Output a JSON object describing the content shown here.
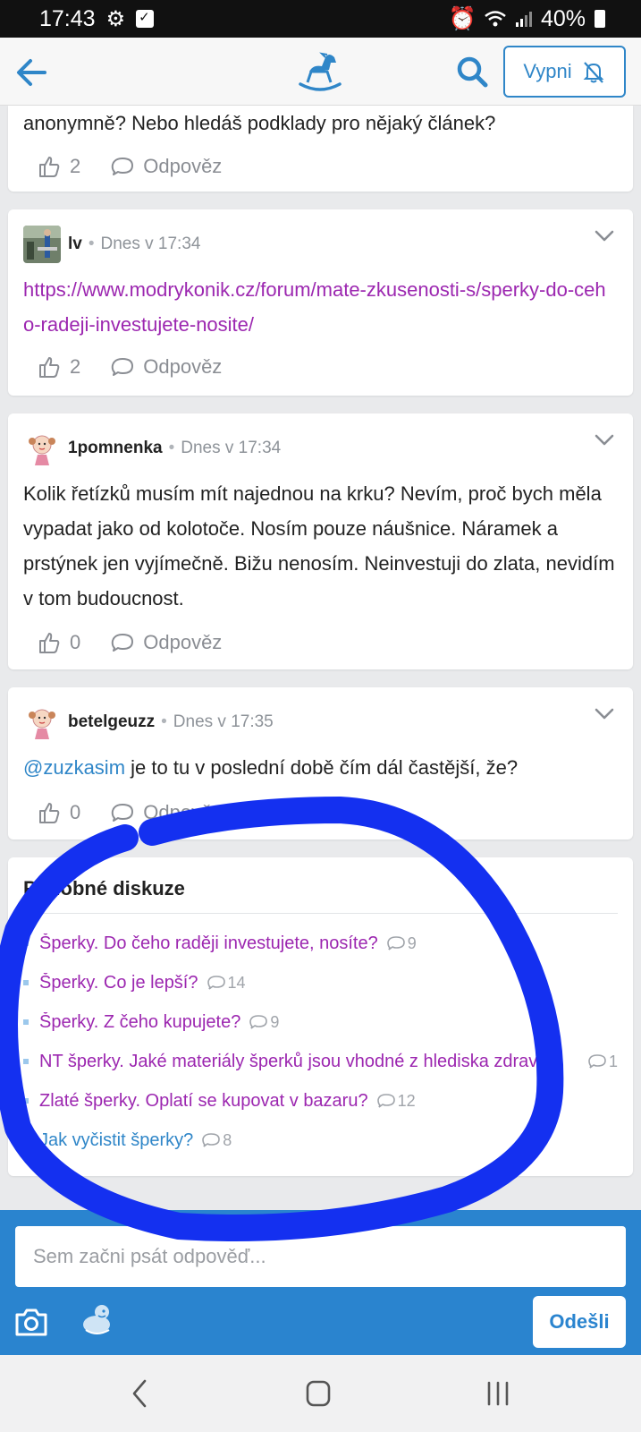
{
  "status_bar": {
    "time": "17:43",
    "battery": "40%"
  },
  "header": {
    "mute_label": "Vypni"
  },
  "posts": [
    {
      "text": "anonymně? Nebo hledáš podklady pro nějaký článek?",
      "likes": "2",
      "reply_label": "Odpověz"
    },
    {
      "username": "lv",
      "time": "Dnes v 17:34",
      "link": "https://www.modrykonik.cz/forum/mate-zkusenosti-s/sperky-do-ceho-radeji-investujete-nosite/",
      "likes": "2",
      "reply_label": "Odpověz"
    },
    {
      "username": "1pomnenka",
      "time": "Dnes v 17:34",
      "text": "Kolik řetízků musím mít najednou na krku? Nevím, proč bych měla vypadat jako od kolotoče. Nosím pouze náušnice. Náramek a prstýnek jen vyjímečně. Bižu nenosím. Neinvestuji do zlata, nevidím v tom budoucnost.",
      "likes": "0",
      "reply_label": "Odpověz"
    },
    {
      "username": "betelgeuzz",
      "time": "Dnes v 17:35",
      "mention": "@zuzkasim",
      "text": " je to tu v poslední době čím dál častější, že?",
      "likes": "0",
      "reply_label": "Odpověz"
    }
  ],
  "similar": {
    "title": "Podobné diskuze",
    "items": [
      {
        "title": "Šperky. Do čeho raději investujete, nosíte?",
        "count": "9"
      },
      {
        "title": "Šperky. Co je lepší?",
        "count": "14"
      },
      {
        "title": "Šperky. Z čeho kupujete?",
        "count": "9"
      },
      {
        "title": "NT šperky. Jaké materiály šperků jsou vhodné z hlediska zdraví?",
        "count": "1"
      },
      {
        "title": "Zlaté šperky. Oplatí se kupovat v bazaru?",
        "count": "12"
      },
      {
        "title": "Jak vyčistit šperky?",
        "count": "8"
      }
    ]
  },
  "composer": {
    "placeholder": "Sem začni psát odpověď...",
    "send_label": "Odešli"
  },
  "colors": {
    "brand_blue": "#2a84cf",
    "visited_link": "#9c27b0",
    "annotation_scribble": "#1430f0"
  }
}
